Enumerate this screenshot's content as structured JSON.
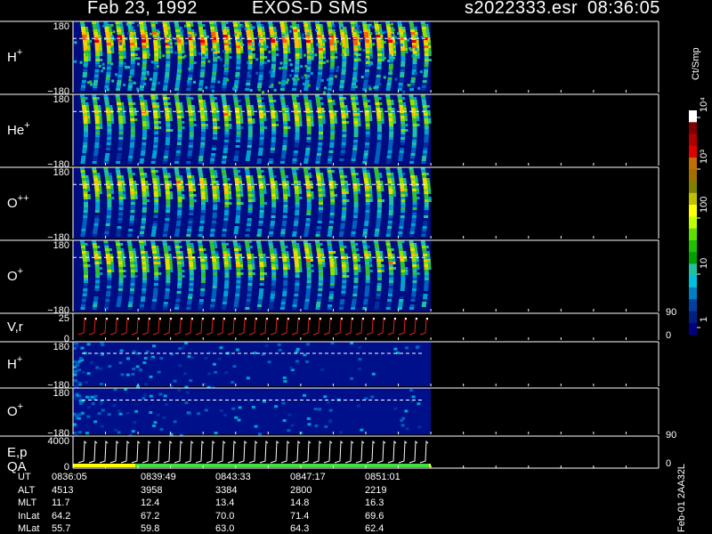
{
  "header": {
    "date": "Feb 23, 1992",
    "instrument": "EXOS-D SMS",
    "file": "s2022333.esr",
    "time": "08:36:05"
  },
  "colorbar": {
    "title": "Ct/Smp",
    "ticks": [
      "10⁴",
      "10³",
      "100",
      "10",
      "1"
    ],
    "colors": [
      "#ffffff",
      "#800000",
      "#b00000",
      "#e00000",
      "#c07000",
      "#a07000",
      "#808000",
      "#c0c000",
      "#ffff00",
      "#c0ff00",
      "#60e000",
      "#20c000",
      "#00a000",
      "#20c0a0",
      "#00c0e0",
      "#0080c0",
      "#0040a0",
      "#002080",
      "#000080"
    ]
  },
  "chart_data": {
    "type": "heatmap",
    "panels": [
      {
        "name": "H⁺",
        "label_main": "H",
        "label_sup": "+",
        "ytop": "180",
        "ybot": "−180",
        "intensity": "high"
      },
      {
        "name": "He⁺",
        "label_main": "He",
        "label_sup": "+",
        "ytop": "180",
        "ybot": "−180",
        "intensity": "medium"
      },
      {
        "name": "O⁺⁺",
        "label_main": "O",
        "label_sup": "++",
        "ytop": "180",
        "ybot": "−180",
        "intensity": "medium"
      },
      {
        "name": "O⁺",
        "label_main": "O",
        "label_sup": "+",
        "ytop": "180",
        "ybot": "−180",
        "intensity": "medium"
      },
      {
        "name": "V,r",
        "label_main": "V,r",
        "label_sup": "",
        "ytop": "25",
        "ybot": "0",
        "right_top": "90",
        "right_bot": "0"
      },
      {
        "name": "H⁺ (2)",
        "label_main": "H",
        "label_sup": "+",
        "ytop": "180",
        "ybot": "−180",
        "intensity": "low"
      },
      {
        "name": "O⁺ (2)",
        "label_main": "O",
        "label_sup": "+",
        "ytop": "180",
        "ybot": "−180",
        "intensity": "low"
      },
      {
        "name": "E,p QA",
        "label_main": "E,p",
        "label_sub": "QA",
        "ytop": "4000",
        "ybot": "0",
        "right_top": "90",
        "right_bot": "0"
      }
    ],
    "xaxis_ticks": [
      "0836:05",
      "0839:49",
      "0843:33",
      "0847:17",
      "0851:01"
    ],
    "ephemeris": [
      {
        "label": "UT",
        "values": [
          "0836:05",
          "0839:49",
          "0843:33",
          "0847:17",
          "0851:01"
        ]
      },
      {
        "label": "ALT",
        "values": [
          "4513",
          "3958",
          "3384",
          "2800",
          "2219"
        ]
      },
      {
        "label": "MLT",
        "values": [
          "11.7",
          "12.4",
          "13.4",
          "14.8",
          "16.3"
        ]
      },
      {
        "label": "InLat",
        "values": [
          "64.2",
          "67.2",
          "70.0",
          "71.4",
          "69.6"
        ]
      },
      {
        "label": "MLat",
        "values": [
          "55.7",
          "59.8",
          "63.0",
          "64.3",
          "62.4"
        ]
      }
    ]
  },
  "side_note": "Feb-01 2AA32L"
}
